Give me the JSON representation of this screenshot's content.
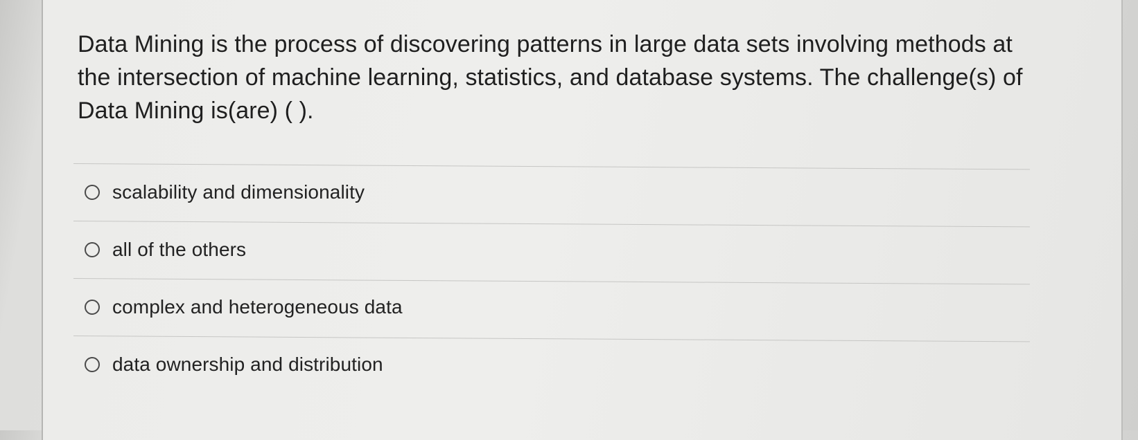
{
  "question": {
    "text": "Data Mining is the process of discovering patterns in large data sets involving methods at the intersection of machine learning, statistics, and database systems. The challenge(s) of Data Mining is(are) ( )."
  },
  "options": [
    {
      "label": "scalability and dimensionality",
      "selected": false
    },
    {
      "label": "all of the others",
      "selected": false
    },
    {
      "label": "complex and heterogeneous data",
      "selected": false
    },
    {
      "label": "data ownership and distribution",
      "selected": false
    }
  ],
  "colors": {
    "text": "#222222",
    "divider": "#c6c6c4",
    "background": "#e3e3e1"
  }
}
